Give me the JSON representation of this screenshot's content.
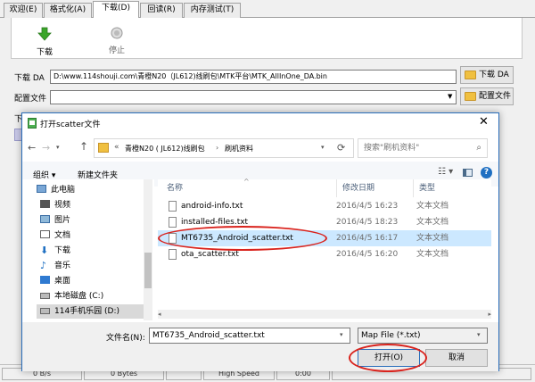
{
  "tabs": [
    "欢迎(E)",
    "格式化(A)",
    "下载(D)",
    "回读(R)",
    "内存测试(T)"
  ],
  "active_tab": 2,
  "toolbar": {
    "download_label": "下载",
    "stop_label": "停止"
  },
  "download_agent": {
    "label": "下载 DA",
    "value": "D:\\www.114shouji.com\\青橙N20（JL612)线刷包\\MTK平台\\MTK_AllInOne_DA.bin",
    "button": "下载 DA"
  },
  "scatter": {
    "label": "配置文件",
    "value": "",
    "button": "配置文件"
  },
  "partial_label": "下",
  "statusbar": [
    "0 B/s",
    "0 Bytes",
    "",
    "High Speed",
    "0:00"
  ],
  "dialog": {
    "title": "打开scatter文件",
    "breadcrumb": {
      "prefix": "«",
      "parts": [
        "青橙N20 ( JL612)线刷包",
        "刷机资料"
      ]
    },
    "search_placeholder": "搜索\"刷机资料\"",
    "organize": "组织 ▾",
    "new_folder": "新建文件夹",
    "nav_items": [
      {
        "label": "此电脑",
        "icon": "computer-icon"
      },
      {
        "label": "视频",
        "icon": "video-icon"
      },
      {
        "label": "图片",
        "icon": "picture-icon"
      },
      {
        "label": "文档",
        "icon": "document-icon"
      },
      {
        "label": "下载",
        "icon": "download-icon"
      },
      {
        "label": "音乐",
        "icon": "music-icon"
      },
      {
        "label": "桌面",
        "icon": "desktop-icon"
      },
      {
        "label": "本地磁盘 (C:)",
        "icon": "drive-icon"
      },
      {
        "label": "114手机乐园 (D:)",
        "icon": "drive-icon"
      }
    ],
    "columns": {
      "name": "名称",
      "modified": "修改日期",
      "type": "类型"
    },
    "files": [
      {
        "name": "android-info.txt",
        "modified": "2016/4/5 16:23",
        "type": "文本文档"
      },
      {
        "name": "installed-files.txt",
        "modified": "2016/4/5 18:23",
        "type": "文本文档"
      },
      {
        "name": "MT6735_Android_scatter.txt",
        "modified": "2016/4/5 16:17",
        "type": "文本文档"
      },
      {
        "name": "ota_scatter.txt",
        "modified": "2016/4/5 16:20",
        "type": "文本文档"
      }
    ],
    "selected_file": 2,
    "filename_label": "文件名(N):",
    "filename_value": "MT6735_Android_scatter.txt",
    "filter_value": "Map File (*.txt)",
    "open_button": "打开(O)",
    "cancel_button": "取消"
  },
  "colors": {
    "accent": "#2a6ebb",
    "highlight": "#d9231d",
    "selection": "#cce8ff",
    "download_arrow": "#3aa52a"
  }
}
